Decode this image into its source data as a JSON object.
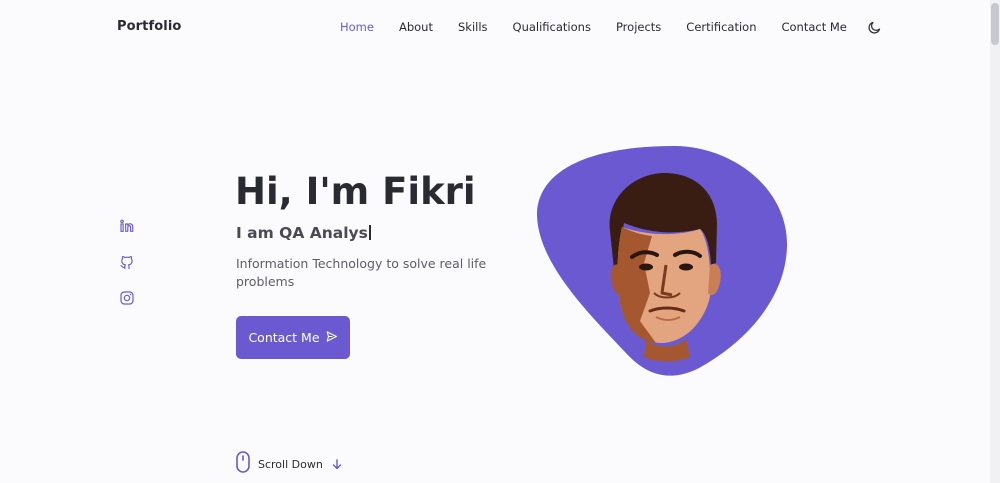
{
  "header": {
    "logo": "Portfolio",
    "nav": [
      "Home",
      "About",
      "Skills",
      "Qualifications",
      "Projects",
      "Certification",
      "Contact Me"
    ],
    "active": "Home",
    "theme_icon": "moon-icon"
  },
  "social": [
    {
      "icon": "linkedin-icon"
    },
    {
      "icon": "github-icon"
    },
    {
      "icon": "instagram-icon"
    }
  ],
  "hero": {
    "title": "Hi, I'm Fikri",
    "subtitle": "I am QA Analys",
    "description": "Information Technology to solve real life problems",
    "button_label": "Contact Me",
    "button_icon": "send-icon"
  },
  "scroll": {
    "label": "Scroll Down",
    "mouse_icon": "mouse-icon",
    "arrow_icon": "arrow-down-icon"
  },
  "colors": {
    "accent": "#6a59d1",
    "background": "#fbfbfe",
    "text": "#2a2a33",
    "muted": "#5d5d66"
  }
}
